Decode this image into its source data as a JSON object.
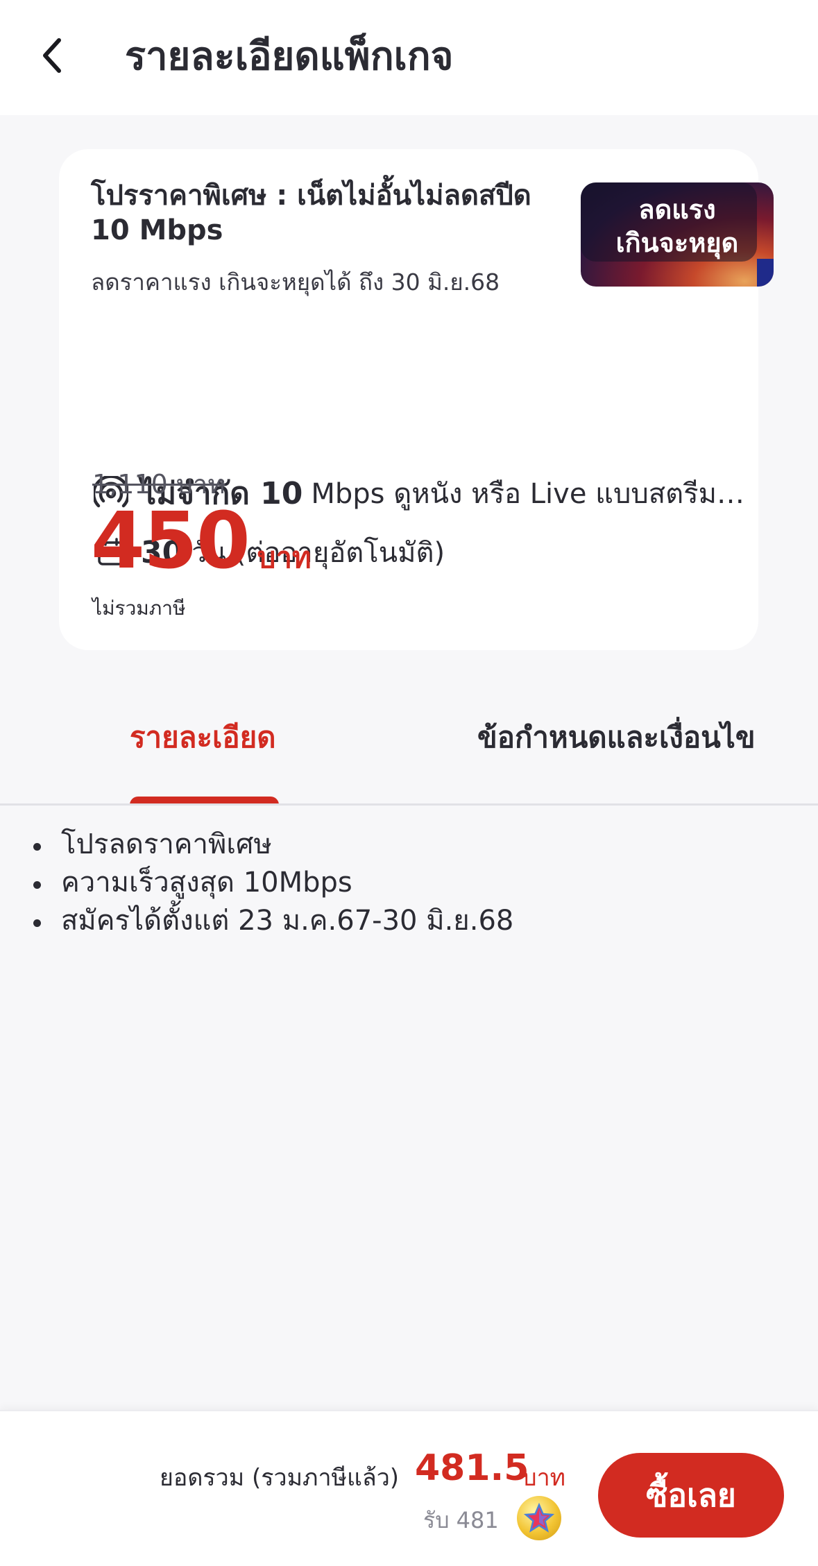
{
  "header": {
    "title": "รายละเอียดแพ็กเกจ",
    "back_icon": "chevron-left-icon"
  },
  "package": {
    "name": "โปรราคาพิเศษ : เน็ตไม่อั้นไม่ลดสปีด 10 Mbps",
    "subtitle": "ลดราคาแรง เกินจะหยุดได้ ถึง 30 มิ.ย.68",
    "promo_badge": {
      "line1": "ลดแรง",
      "line2": "เกินจะหยุด"
    },
    "features": [
      {
        "icon": "signal-icon",
        "strong": "ไม่จำกัด 10",
        "text": "Mbps ดูหนัง หรือ Live แบบสตรีมมิ่ง"
      },
      {
        "icon": "calendar-icon",
        "strong": "30",
        "text": "วัน (ต่ออายุอัตโนมัติ)"
      }
    ],
    "old_price": "1,110 บาท",
    "price": "450",
    "price_unit": "บาท",
    "tax_note": "ไม่รวมภาษี"
  },
  "tabs": {
    "items": [
      {
        "label": "รายละเอียด",
        "active": true
      },
      {
        "label": "ข้อกำหนดและเงื่อนไข",
        "active": false
      }
    ]
  },
  "details": {
    "items": [
      "โปรลดราคาพิเศษ",
      "ความเร็วสูงสุด 10Mbps",
      "สมัครได้ตั้งแต่ 23 ม.ค.67-30 มิ.ย.68"
    ]
  },
  "footer": {
    "total_label": "ยอดรวม (รวมภาษีแล้ว)",
    "total_value": "481.5",
    "total_unit": "บาท",
    "reward_label": "รับ 481",
    "reward_icon": "star-coin-icon",
    "buy_label": "ซื้อเลย"
  },
  "colors": {
    "accent": "#d22b21",
    "background": "#f7f7f9",
    "text": "#2b2b33"
  }
}
